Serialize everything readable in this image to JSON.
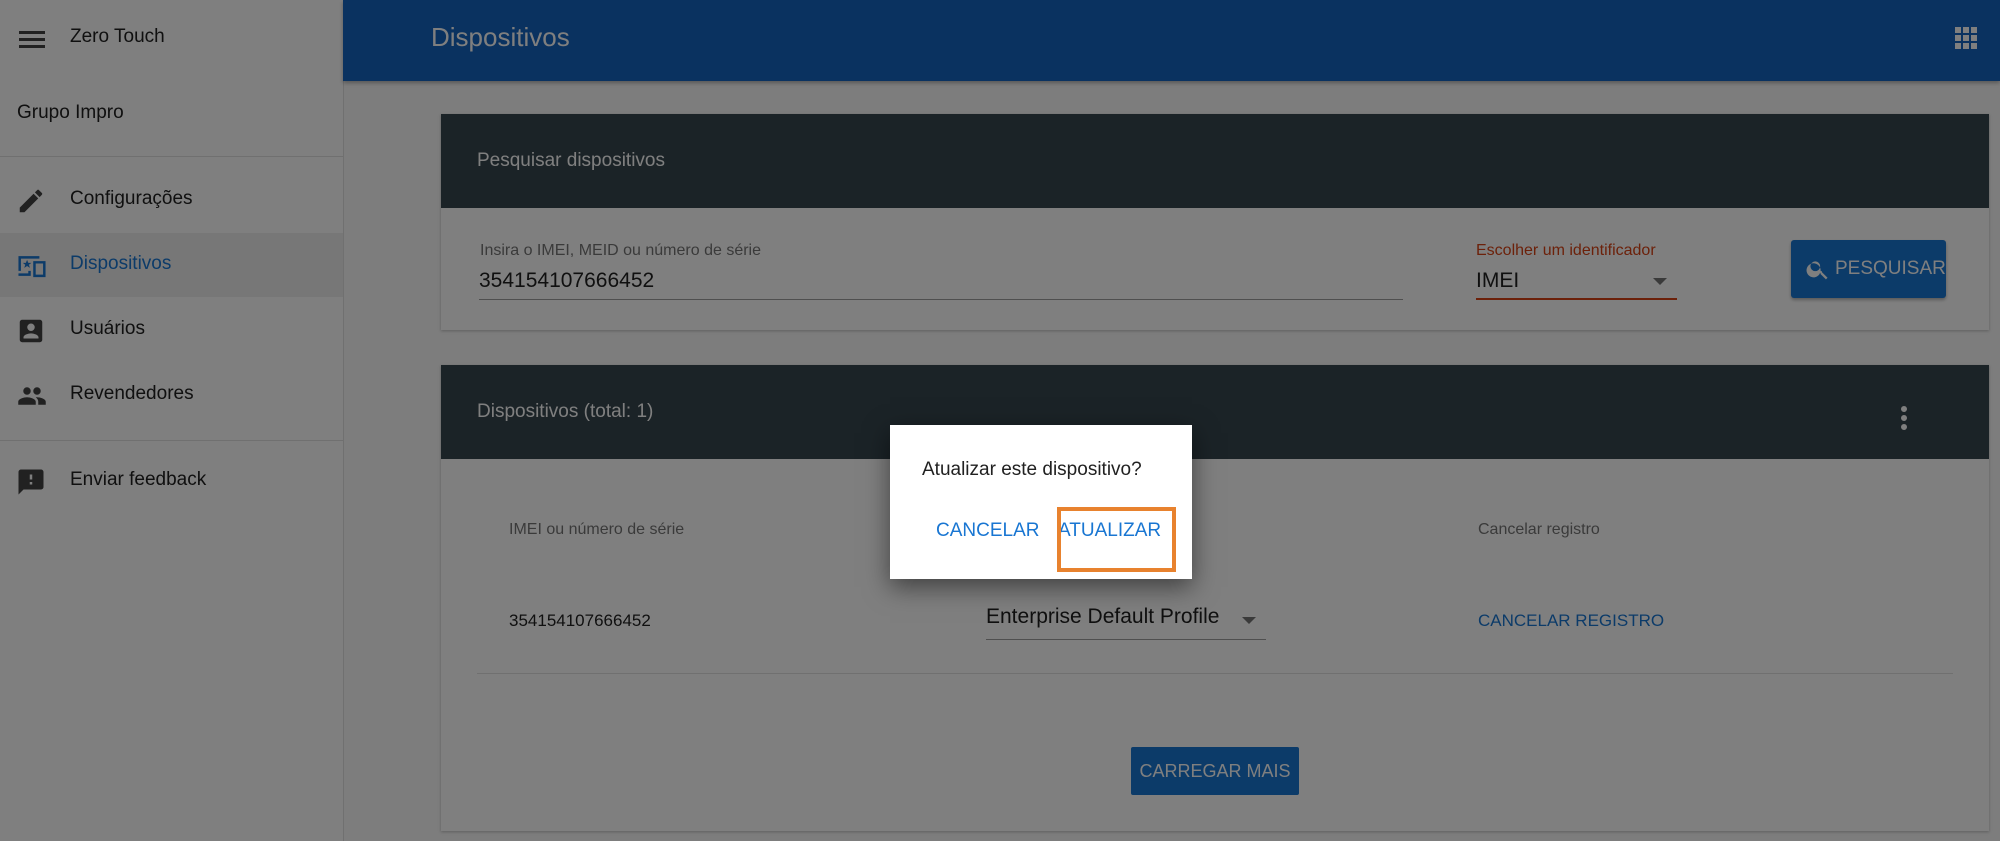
{
  "app": {
    "title": "Zero Touch",
    "organization": "Grupo Impro"
  },
  "sidebar": {
    "items": [
      {
        "label": "Configurações",
        "icon": "pencil-icon"
      },
      {
        "label": "Dispositivos",
        "icon": "devices-icon",
        "active": true
      },
      {
        "label": "Usuários",
        "icon": "account-box-icon"
      },
      {
        "label": "Revendedores",
        "icon": "people-icon"
      }
    ],
    "feedback": {
      "label": "Enviar feedback",
      "icon": "feedback-icon"
    }
  },
  "header": {
    "title": "Dispositivos",
    "apps_icon": "apps-grid-icon"
  },
  "search": {
    "title": "Pesquisar dispositivos",
    "input_label": "Insira o IMEI, MEID ou número de série",
    "input_value": "354154107666452",
    "select_label": "Escolher um identificador",
    "select_value": "IMEI",
    "button_label": "PESQUISAR"
  },
  "devices": {
    "title": "Dispositivos (total: 1)",
    "columns": [
      "IMEI ou número de série",
      "Cancelar registro"
    ],
    "rows": [
      {
        "serial": "354154107666452",
        "profile": "Enterprise Default Profile",
        "action": "CANCELAR REGISTRO"
      }
    ],
    "load_more_label": "CARREGAR MAIS"
  },
  "dialog": {
    "message": "Atualizar este dispositivo?",
    "cancel_label": "CANCELAR",
    "confirm_label": "ATUALIZAR"
  },
  "colors": {
    "primary": "#1976d2",
    "app_bar": "#1565c0",
    "card_header": "#37474f",
    "error": "#d84315",
    "highlight": "#e8822e"
  }
}
